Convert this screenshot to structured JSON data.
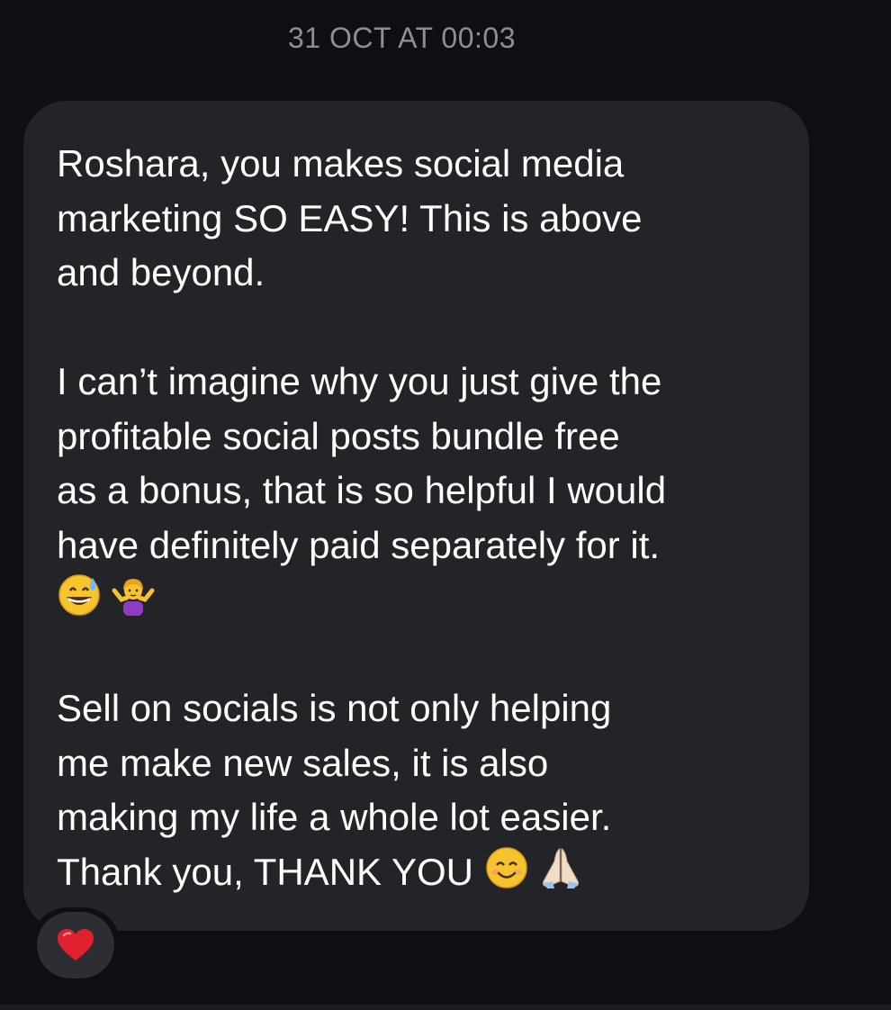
{
  "chat": {
    "timestamp": "31 OCT AT 00:03",
    "message": {
      "paragraph_1": "Roshara, you makes social media\nmarketing SO EASY! This is above\nand beyond.",
      "paragraph_2": "I can’t imagine why you just give the\nprofitable social posts bundle free\nas a bonus, that is so helpful I would\nhave definitely paid separately for it.",
      "paragraph_2_emojis": [
        "grinning-sweat-emoji",
        "shrugging-woman-emoji"
      ],
      "paragraph_3": "Sell on socials is not only helping\nme make new sales, it is also\nmaking my life a whole lot easier.\nThank you, THANK YOU",
      "paragraph_3_emojis": [
        "smiling-face-emoji",
        "folded-hands-emoji"
      ]
    },
    "reaction": {
      "icon": "red-heart-icon"
    }
  },
  "colors": {
    "background": "#0d0f13",
    "bubble": "#222428",
    "timestamp_text": "#8e8e93",
    "message_text": "#ffffff",
    "reaction_pill": "#2c2e33",
    "heart": "#e0202f"
  }
}
